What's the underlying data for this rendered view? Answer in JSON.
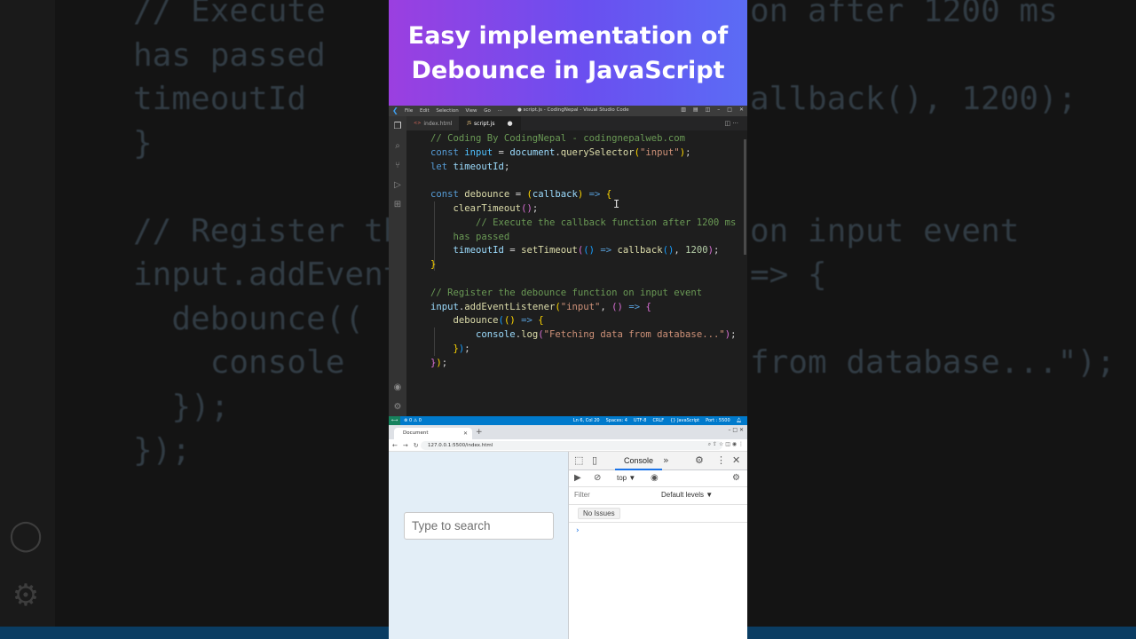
{
  "banner": {
    "title": "Easy implementation of Debounce in JavaScript"
  },
  "background": {
    "left_lines": [
      "// Execute",
      "has passed",
      "timeoutId",
      "}",
      "",
      "// Register th",
      "input.addEvent(",
      "  debounce((",
      "    console",
      "  });",
      "});"
    ],
    "right_lines": [
      "on after 1200 ms",
      "",
      "allback(), 1200);",
      "",
      "",
      "on input event",
      "=> {",
      "",
      "from database...\");",
      "",
      ""
    ]
  },
  "vscode": {
    "menu": [
      "File",
      "Edit",
      "Selection",
      "View",
      "Go",
      "···"
    ],
    "window_title": "● script.js - CodingNepal - Visual Studio Code",
    "tabs": [
      {
        "label": "index.html",
        "active": false,
        "type": "html"
      },
      {
        "label": "script.js",
        "active": true,
        "type": "js"
      }
    ],
    "code_lines": [
      "// Coding By CodingNepal - codingnepalweb.com",
      "const input = document.querySelector(\"input\");",
      "let timeoutId;",
      "",
      "const debounce = (callback) => {",
      "    clearTimeout();",
      "    // Execute the callback function after 1200 ms",
      "    has passed",
      "    timeoutId = setTimeout(() => callback(), 1200);",
      "}",
      "",
      "// Register the debounce function on input event",
      "input.addEventListener(\"input\", () => {",
      "    debounce(() => {",
      "        console.log(\"Fetching data from database...\");",
      "    });",
      "});"
    ],
    "status": {
      "errors": "⊗ 0 ⚠ 0",
      "position": "Ln 6, Col 20",
      "spaces": "Spaces: 4",
      "encoding": "UTF-8",
      "eol": "CRLF",
      "language": "{} JavaScript",
      "port": "Port : 5500"
    }
  },
  "browser": {
    "tab_title": "Document",
    "url": "127.0.0.1:5500/index.html",
    "search": {
      "placeholder": "Type to search"
    },
    "devtools": {
      "panel_tab": "Console",
      "context": "top",
      "filter_placeholder": "Filter",
      "levels": "Default levels",
      "issues": "No Issues"
    }
  }
}
